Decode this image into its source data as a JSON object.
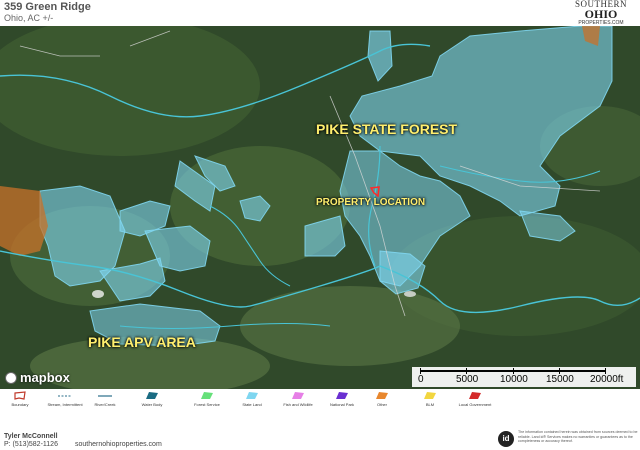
{
  "header": {
    "title": "359 Green Ridge",
    "subtitle": "Ohio, AC +/-"
  },
  "logo": {
    "line1": "SOUTHERN",
    "line2": "OHIO",
    "line3": "PROPERTIES.COM"
  },
  "map": {
    "labels": {
      "pike_state_forest": "PIKE STATE FOREST",
      "property_location": "PROPERTY LOCATION",
      "pike_apv_area": "PIKE APV AREA"
    },
    "attribution": "mapbox",
    "scale": {
      "ticks": [
        "0",
        "5000",
        "10000",
        "15000",
        "20000ft"
      ]
    }
  },
  "legend": {
    "items": [
      {
        "label": "Boundary",
        "icon": "boundary-outline",
        "color": "#c0392b"
      },
      {
        "label": "Stream, Intermittent",
        "icon": "dashed-line",
        "color": "#2a6e8a"
      },
      {
        "label": "River/Creek",
        "icon": "solid-line",
        "color": "#2a6e8a"
      },
      {
        "label": "Water Body",
        "icon": "water-shape",
        "color": "#1a6b82"
      },
      {
        "label": "Forest Service",
        "icon": "area-shape",
        "color": "#66e07a"
      },
      {
        "label": "State Land",
        "icon": "area-shape",
        "color": "#7fd6f0"
      },
      {
        "label": "Fish and Wildlife",
        "icon": "area-shape",
        "color": "#e67fe6"
      },
      {
        "label": "National Park",
        "icon": "area-shape",
        "color": "#6a2fd1"
      },
      {
        "label": "Other",
        "icon": "area-shape",
        "color": "#e8872e"
      },
      {
        "label": "BLM",
        "icon": "area-shape",
        "color": "#f2d640"
      },
      {
        "label": "Local Government",
        "icon": "area-shape",
        "color": "#d42a2a"
      }
    ]
  },
  "footer": {
    "agent": "Tyler McConnell",
    "phone": "P: (513)582-1126",
    "website": "southernohioproperties.com",
    "id_logo": "id",
    "disclaimer": "The information contained herein was obtained from sources deemed to be reliable. Land id® Services makes no warranties or guarantees as to the completeness or accuracy thereof."
  },
  "colors": {
    "state_land": "#7fd6f0",
    "other": "#c8722a",
    "boundary": "#ff2a2a",
    "label_yellow": "#ffef6e"
  }
}
